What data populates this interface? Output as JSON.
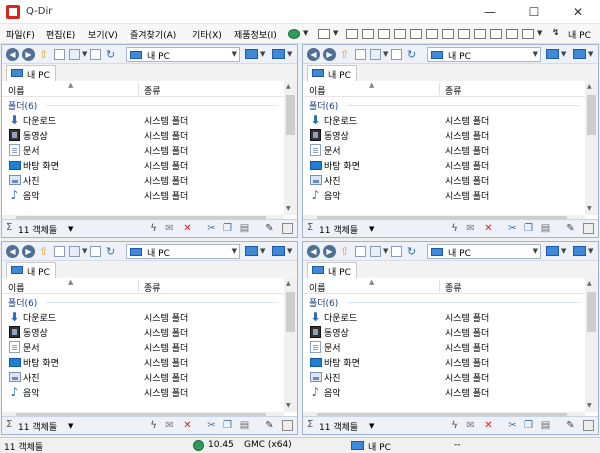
{
  "window": {
    "title": "Q-Dir",
    "minimize": "—",
    "maximize": "☐",
    "close": "✕"
  },
  "menu": {
    "items": [
      "파일(F)",
      "편집(E)",
      "보기(V)",
      "즐겨찾기(A)",
      "기타(X)",
      "제품정보(I)"
    ],
    "right_label": "내 PC"
  },
  "panes": [
    {
      "address": "내 PC",
      "tab": "내 PC",
      "columns": {
        "name": "이름",
        "type": "종류"
      },
      "group": "폴더(6)",
      "rows": [
        {
          "name": "다운로드",
          "type": "시스템 폴더",
          "icon": "download-icon"
        },
        {
          "name": "동영상",
          "type": "시스템 폴더",
          "icon": "video-icon"
        },
        {
          "name": "문서",
          "type": "시스템 폴더",
          "icon": "document-icon"
        },
        {
          "name": "바탕 화면",
          "type": "시스템 폴더",
          "icon": "desktop-icon"
        },
        {
          "name": "사진",
          "type": "시스템 폴더",
          "icon": "picture-icon"
        },
        {
          "name": "음악",
          "type": "시스템 폴더",
          "icon": "music-icon"
        }
      ],
      "status": "11 객체들"
    },
    {
      "address": "내 PC",
      "tab": "내 PC",
      "columns": {
        "name": "이름",
        "type": "종류"
      },
      "group": "폴더(6)",
      "rows": [
        {
          "name": "다운로드",
          "type": "시스템 폴더",
          "icon": "download-icon"
        },
        {
          "name": "동영상",
          "type": "시스템 폴더",
          "icon": "video-icon"
        },
        {
          "name": "문서",
          "type": "시스템 폴더",
          "icon": "document-icon"
        },
        {
          "name": "바탕 화면",
          "type": "시스템 폴더",
          "icon": "desktop-icon"
        },
        {
          "name": "사진",
          "type": "시스템 폴더",
          "icon": "picture-icon"
        },
        {
          "name": "음악",
          "type": "시스템 폴더",
          "icon": "music-icon"
        }
      ],
      "status": "11 객체들"
    },
    {
      "address": "내 PC",
      "tab": "내 PC",
      "columns": {
        "name": "이름",
        "type": "종류"
      },
      "group": "폴더(6)",
      "rows": [
        {
          "name": "다운로드",
          "type": "시스템 폴더",
          "icon": "download-icon"
        },
        {
          "name": "동영상",
          "type": "시스템 폴더",
          "icon": "video-icon"
        },
        {
          "name": "문서",
          "type": "시스템 폴더",
          "icon": "document-icon"
        },
        {
          "name": "바탕 화면",
          "type": "시스템 폴더",
          "icon": "desktop-icon"
        },
        {
          "name": "사진",
          "type": "시스템 폴더",
          "icon": "picture-icon"
        },
        {
          "name": "음악",
          "type": "시스템 폴더",
          "icon": "music-icon"
        }
      ],
      "status": "11 객체들"
    },
    {
      "address": "내 PC",
      "tab": "내 PC",
      "columns": {
        "name": "이름",
        "type": "종류"
      },
      "group": "폴더(6)",
      "rows": [
        {
          "name": "다운로드",
          "type": "시스템 폴더",
          "icon": "download-icon"
        },
        {
          "name": "동영상",
          "type": "시스템 폴더",
          "icon": "video-icon"
        },
        {
          "name": "문서",
          "type": "시스템 폴더",
          "icon": "document-icon"
        },
        {
          "name": "바탕 화면",
          "type": "시스템 폴더",
          "icon": "desktop-icon"
        },
        {
          "name": "사진",
          "type": "시스템 폴더",
          "icon": "picture-icon"
        },
        {
          "name": "음악",
          "type": "시스템 폴더",
          "icon": "music-icon"
        }
      ],
      "status": "11 객체들"
    }
  ],
  "statusbar": {
    "left": "11 객체들",
    "time": "10.45",
    "tz": "GMC (x64)",
    "location": "내 PC",
    "extra": "--"
  }
}
